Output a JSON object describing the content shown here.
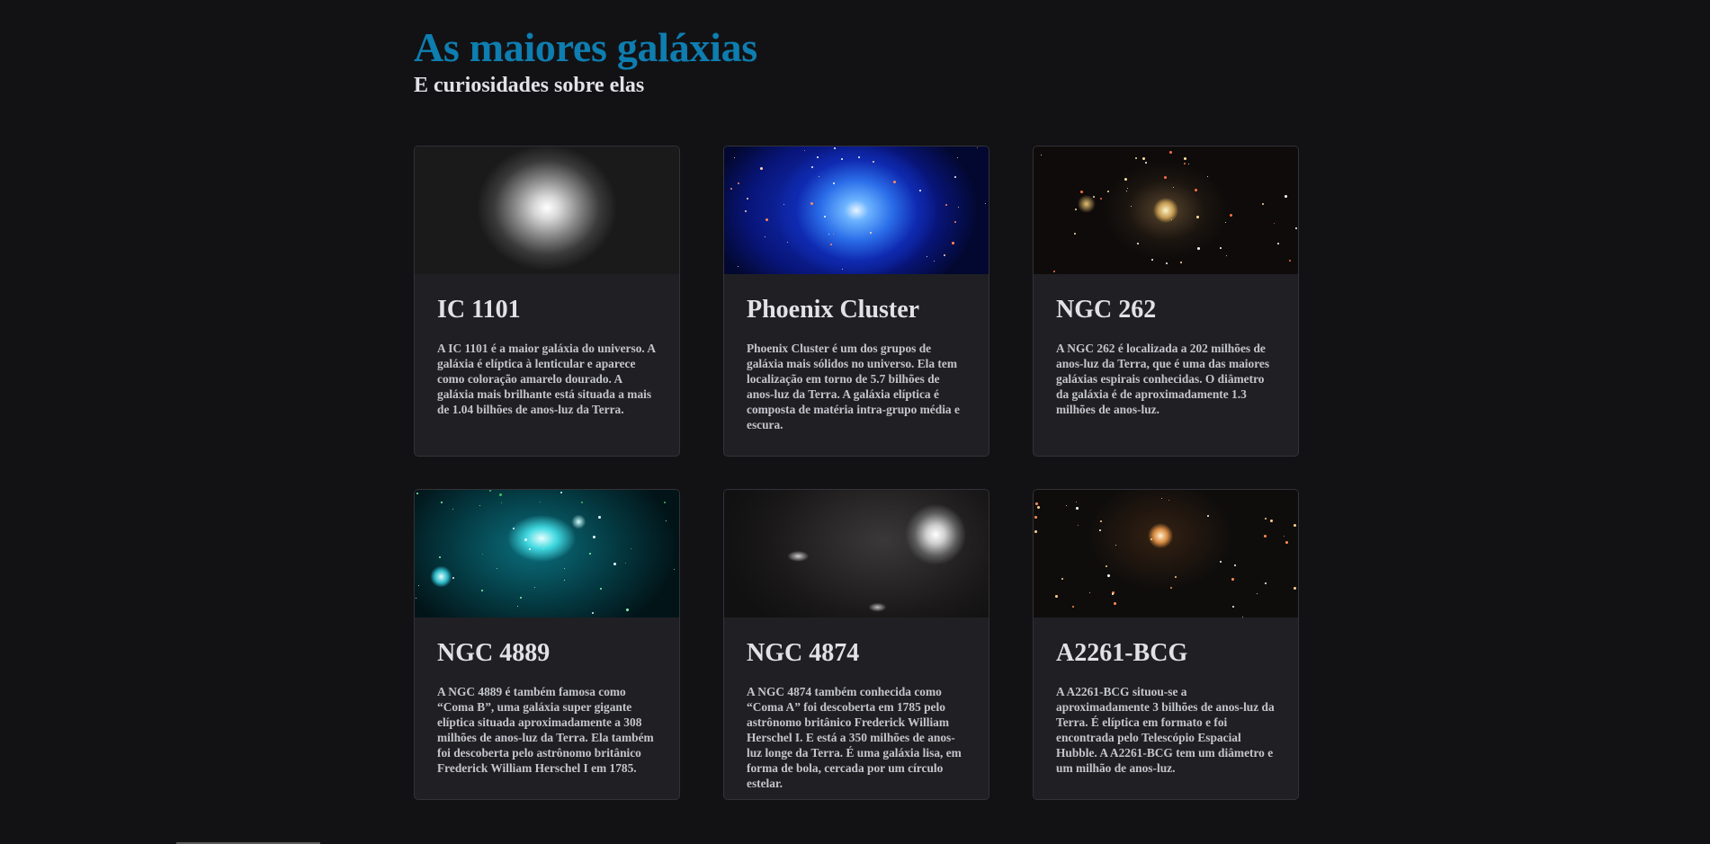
{
  "header": {
    "title": "As maiores galáxias",
    "subtitle": "E curiosidades sobre elas"
  },
  "colors": {
    "background": "#121214",
    "card": "#202024",
    "accent": "#0e7db0",
    "text": "#e1e1e6"
  },
  "galaxies": [
    {
      "name": "IC 1101",
      "description": "A IC 1101 é a maior galáxia do universo. A galáxia é elíptica à lenticular e aparece como coloração amarelo dourado. A galáxia mais brilhante está situada a mais de 1.04 bilhões de anos-luz da Terra."
    },
    {
      "name": "Phoenix Cluster",
      "description": "Phoenix Cluster é um dos grupos de galáxia mais sólidos no universo. Ela tem localização em torno de 5.7 bilhões de anos-luz da Terra. A galáxia elíptica é composta de matéria intra-grupo média e escura."
    },
    {
      "name": "NGC 262",
      "description": "A NGC 262 é localizada a 202 milhões de anos-luz da Terra, que é uma das maiores galáxias espirais conhecidas. O diâmetro da galáxia é de aproximadamente 1.3 milhões de anos-luz."
    },
    {
      "name": "NGC 4889",
      "description": "A NGC 4889 é também famosa como “Coma B”, uma galáxia super gigante elíptica situada aproximadamente a 308 milhões de anos-luz da Terra. Ela também foi descoberta pelo astrônomo britânico Frederick William Herschel I em 1785."
    },
    {
      "name": "NGC 4874",
      "description": "A NGC 4874 também conhecida como “Coma A” foi descoberta em 1785 pelo astrônomo britânico Frederick William Herschel I. E está a 350 milhões de anos-luz longe da Terra. É uma galáxia lisa, em forma de bola, cercada por um círculo estelar."
    },
    {
      "name": "A2261-BCG",
      "description": "A A2261-BCG situou-se a aproximadamente 3 bilhões de anos-luz da Terra. É elíptica em formato e foi encontrada pelo Telescópio Espacial Hubble. A A2261-BCG tem um diâmetro e um milhão de anos-luz."
    }
  ]
}
